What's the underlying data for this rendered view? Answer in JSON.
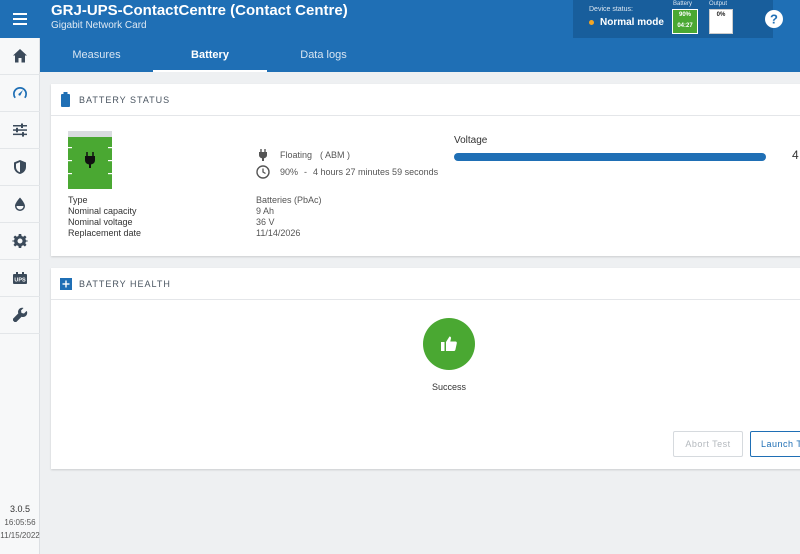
{
  "app": {
    "title": "GRJ-UPS-ContactCentre (Contact Centre)",
    "subtitle": "Gigabit Network Card"
  },
  "device_status": {
    "label": "Device status:",
    "mode": "Normal mode",
    "mode_color": "#f5a623",
    "battery_label": "Battery",
    "battery_percent": "90%",
    "battery_time": "04:27",
    "output_label": "Output",
    "output_percent": "0%"
  },
  "tabs": [
    {
      "label": "Measures"
    },
    {
      "label": "Battery",
      "active": true
    },
    {
      "label": "Data logs"
    }
  ],
  "sidebar": {
    "items": [
      "home-icon",
      "dashboard-icon",
      "sliders-icon",
      "shield-icon",
      "drop-icon",
      "gear-icon",
      "ups-icon",
      "wrench-icon"
    ],
    "version": "3.0.5",
    "time": "16:05:56",
    "date": "11/15/2022"
  },
  "battery_status": {
    "title": "BATTERY STATUS",
    "state": "Floating",
    "state_detail": "( ABM )",
    "charge": "90%",
    "separator": "-",
    "runtime": "4 hours 27 minutes 59 seconds",
    "fields": [
      {
        "label": "Type",
        "value": "Batteries (PbAc)"
      },
      {
        "label": "Nominal capacity",
        "value": "9 Ah"
      },
      {
        "label": "Nominal voltage",
        "value": "36 V"
      },
      {
        "label": "Replacement date",
        "value": "11/14/2026"
      }
    ],
    "voltage_title": "Voltage",
    "voltage_value_partial": "4"
  },
  "battery_health": {
    "title": "BATTERY HEALTH",
    "result": "Success",
    "abort_label": "Abort Test",
    "launch_label": "Launch T"
  },
  "colors": {
    "primary": "#1f6fb5",
    "success": "#4aa832"
  }
}
